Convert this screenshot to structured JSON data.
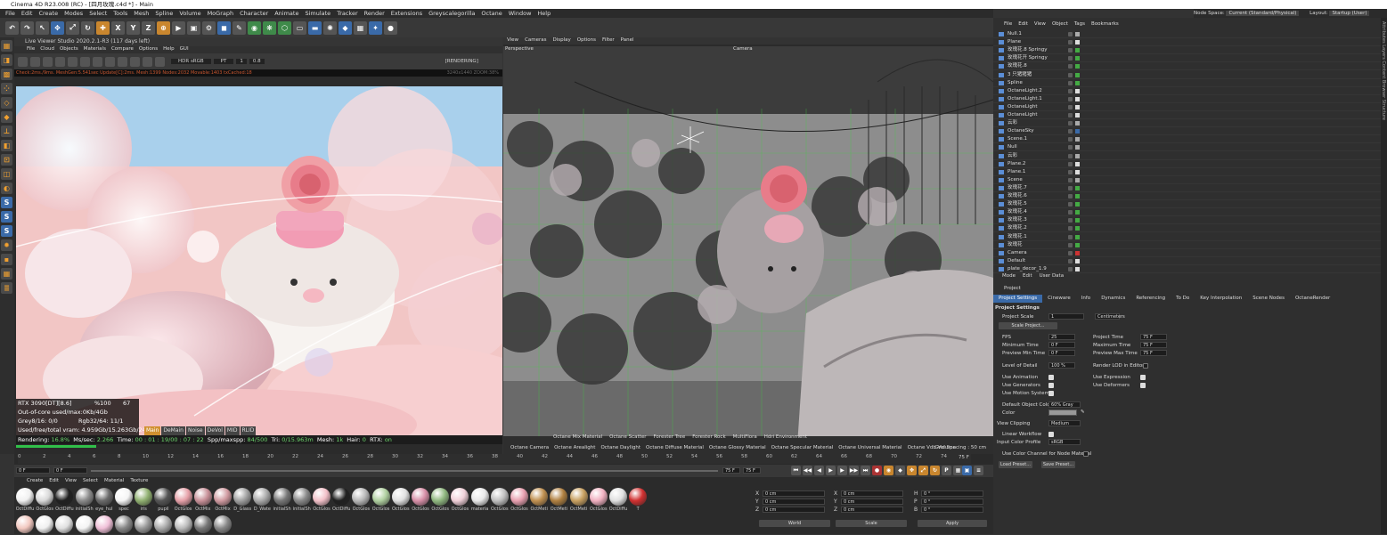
{
  "window": {
    "title": "Cinema 4D R23.008 (RC) - [四月玫瑰.c4d *] - Main"
  },
  "menubar": [
    "File",
    "Edit",
    "Create",
    "Modes",
    "Select",
    "Tools",
    "Mesh",
    "Spline",
    "Volume",
    "MoGraph",
    "Character",
    "Animate",
    "Simulate",
    "Tracker",
    "Render",
    "Extensions",
    "Greyscalegorilla",
    "Octane",
    "Window",
    "Help"
  ],
  "nodespace": {
    "label": "Node Space:",
    "value": "Current (Standard/Physical)",
    "layout_label": "Layout:",
    "layout_value": "Startup (User)"
  },
  "live_viewer": {
    "title": "Live Viewer Studio 2020.2.1-R3 (117 days left)",
    "menu": [
      "File",
      "Cloud",
      "Objects",
      "Materials",
      "Compare",
      "Options",
      "Help",
      "GUI"
    ],
    "status": "[RENDERING]",
    "hdr": "HDR sRGB",
    "pt": "PT",
    "one": "1",
    "zoom": "0.8",
    "info_line": "Check:2ms./9ms. MeshGen:5.541sec Update[C]:2ms. Mesh:1399 Nodes:2032 Movable:1403 txCached:18",
    "info_right": "3240x1440 ZOOM:38%",
    "stats": {
      "gpu": "RTX 3090[DT][8.6]",
      "gpu_pct": "%100",
      "gpu_temp": "67",
      "ooc": "Out-of-core used/max:0Kb/4Gb",
      "grey": "Grey8/16: 0/0",
      "rgb": "Rgb32/64: 11/1",
      "vram": "Used/free/total vram: 4.959Gb/15.263Gb/24Gb"
    },
    "tabs": [
      "Main",
      "DeMain",
      "Noise",
      "DeVol",
      "MID",
      "RLID"
    ],
    "bottom": {
      "rendering_label": "Rendering:",
      "rendering_val": "16.8%",
      "ms_label": "Ms/sec:",
      "ms_val": "2.266",
      "time_label": "Time:",
      "time_val": "00 : 01 : 19/00 : 07 : 22",
      "spp_label": "Spp/maxspp:",
      "spp_val": "84/500",
      "tri_label": "Tri:",
      "tri_val": "0/15.963m",
      "mesh_label": "Mesh:",
      "mesh_val": "1k",
      "hair_label": "Hair:",
      "hair_val": "0",
      "rtx_label": "RTX:",
      "rtx_val": "on"
    }
  },
  "viewport": {
    "menu": [
      "View",
      "Cameras",
      "Display",
      "Options",
      "Filter",
      "Panel"
    ],
    "label": "Perspective",
    "camera": "Camera",
    "bottom_items": [
      "Octane Mix Material",
      "Octane Scatter",
      "Forester Tree",
      "Forester Rock",
      "MultiFlora",
      "Hdri Environment"
    ],
    "bottom_items2": [
      "Octane Camera",
      "Octane Arealight",
      "Octane Daylight",
      "Octane Diffuse Material",
      "Octane Glossy Material",
      "Octane Specular Material",
      "Octane Universal Material",
      "Octane Vdb Volume"
    ],
    "grid_spacing": "Grid Spacing : 50 cm"
  },
  "timeline": {
    "ticks": [
      "0",
      "2",
      "4",
      "6",
      "8",
      "10",
      "12",
      "14",
      "16",
      "18",
      "20",
      "22",
      "24",
      "26",
      "28",
      "30",
      "32",
      "34",
      "36",
      "38",
      "40",
      "42",
      "44",
      "46",
      "48",
      "50",
      "52",
      "54",
      "56",
      "58",
      "60",
      "62",
      "64",
      "66",
      "68",
      "70",
      "72",
      "74"
    ],
    "frame_start": "0 F",
    "frame_cur": "0 F",
    "frame_end": "75 F",
    "frame_end2": "75 F",
    "right_frame": "75 F"
  },
  "material_manager": {
    "menu": [
      "Create",
      "Edit",
      "View",
      "Select",
      "Material",
      "Texture"
    ],
    "row1": [
      {
        "label": "OctDiffu",
        "color": "#f0f0f0"
      },
      {
        "label": "OctGlos",
        "color": "#d8d8d8"
      },
      {
        "label": "OctDiffu",
        "color": "#202020"
      },
      {
        "label": "initialSh",
        "color": "#8a8a8a"
      },
      {
        "label": "eye_hul",
        "color": "#6a6a6a"
      },
      {
        "label": "spec",
        "color": "#f5f5f5"
      },
      {
        "label": "iris",
        "color": "#90b070"
      },
      {
        "label": "pupil",
        "color": "#555"
      },
      {
        "label": "OctGlos",
        "color": "#e6a0a8"
      },
      {
        "label": "OctMix",
        "color": "#c89098"
      },
      {
        "label": "OctMix",
        "color": "#d09aa0"
      },
      {
        "label": "D_Glass",
        "color": "#a0a0a0"
      },
      {
        "label": "D_Wate",
        "color": "#aaaaaa"
      },
      {
        "label": "initialSh",
        "color": "#777"
      },
      {
        "label": "initialSh",
        "color": "#888"
      },
      {
        "label": "OctGlos",
        "color": "#f2c0c8"
      },
      {
        "label": "OctDiffu",
        "color": "#202020"
      },
      {
        "label": "OctGlos",
        "color": "#b8b8b8"
      },
      {
        "label": "OctGlos",
        "color": "#b0d0a0"
      },
      {
        "label": "OctGlos",
        "color": "#e0e0e0"
      },
      {
        "label": "OctGlos",
        "color": "#d890a8"
      },
      {
        "label": "OctGlos",
        "color": "#90b880"
      },
      {
        "label": "OctGlos",
        "color": "#f0d0d8"
      },
      {
        "label": "materia",
        "color": "#e8e8e8"
      },
      {
        "label": "OctGlos",
        "color": "#c0c0c0"
      },
      {
        "label": "OctGlos",
        "color": "#e8a0b0"
      },
      {
        "label": "OctMeti",
        "color": "#c09050"
      },
      {
        "label": "OctMeti",
        "color": "#b08040"
      },
      {
        "label": "OctMeti",
        "color": "#c8a060"
      },
      {
        "label": "OctGlos",
        "color": "#f0b0c0"
      },
      {
        "label": "OctDiffu",
        "color": "#e0e0e0"
      },
      {
        "label": "T",
        "color": "#d03030"
      }
    ],
    "row2_colors": [
      "#f2c8c0",
      "#f0f0f0",
      "#e0e0e0",
      "#f4f4f4",
      "#f0c0d8",
      "#888",
      "#999",
      "#aaa",
      "#bbb",
      "#777",
      "#888"
    ]
  },
  "coords": {
    "rows": [
      {
        "a": "X",
        "av": "0 cm",
        "b": "X",
        "bv": "0 cm",
        "c": "H",
        "cv": "0 °"
      },
      {
        "a": "Y",
        "av": "0 cm",
        "b": "Y",
        "bv": "0 cm",
        "c": "P",
        "cv": "0 °"
      },
      {
        "a": "Z",
        "av": "0 cm",
        "b": "Z",
        "bv": "0 cm",
        "c": "B",
        "cv": "0 °"
      }
    ],
    "world": "World",
    "scale": "Scale",
    "apply": "Apply"
  },
  "object_manager": {
    "menu": [
      "File",
      "Edit",
      "View",
      "Object",
      "Tags",
      "Bookmarks"
    ],
    "items": [
      {
        "name": "Null.1",
        "tag": "#aaa"
      },
      {
        "name": "Plane",
        "tag": "#ddd"
      },
      {
        "name": "玫瑰花.8 Springy",
        "tag": "#4a4"
      },
      {
        "name": "玫瑰花开 Springy",
        "tag": "#4a4"
      },
      {
        "name": "玫瑰花.8",
        "tag": "#4a4"
      },
      {
        "name": "3 只猪猪猪",
        "tag": "#4a4"
      },
      {
        "name": "Spline",
        "tag": "#4a4"
      },
      {
        "name": "OctaneLight.2",
        "tag": "#ddd"
      },
      {
        "name": "OctaneLight.1",
        "tag": "#ddd"
      },
      {
        "name": "OctaneLight",
        "tag": "#ddd"
      },
      {
        "name": "OctaneLight",
        "tag": "#ddd"
      },
      {
        "name": "云彩",
        "tag": "#aaa"
      },
      {
        "name": "OctaneSky",
        "tag": "#3a6aa8"
      },
      {
        "name": "Scene.1",
        "tag": "#aaa"
      },
      {
        "name": "Null",
        "tag": "#aaa"
      },
      {
        "name": "云彩",
        "tag": "#aaa"
      },
      {
        "name": "Plane.2",
        "tag": "#ddd"
      },
      {
        "name": "Plane.1",
        "tag": "#ddd"
      },
      {
        "name": "Scene",
        "tag": "#aaa"
      },
      {
        "name": "玫瑰花.7",
        "tag": "#4a4"
      },
      {
        "name": "玫瑰花.6",
        "tag": "#4a4"
      },
      {
        "name": "玫瑰花.5",
        "tag": "#4a4"
      },
      {
        "name": "玫瑰花.4",
        "tag": "#4a4"
      },
      {
        "name": "玫瑰花.3",
        "tag": "#4a4"
      },
      {
        "name": "玫瑰花.2",
        "tag": "#4a4"
      },
      {
        "name": "玫瑰花.1",
        "tag": "#4a4"
      },
      {
        "name": "玫瑰花",
        "tag": "#4a4"
      },
      {
        "name": "Camera",
        "tag": "#c33"
      },
      {
        "name": "Default",
        "tag": "#ddd"
      },
      {
        "name": "plate_decor_1.9",
        "tag": "#ddd"
      }
    ]
  },
  "attributes": {
    "menu": [
      "Mode",
      "Edit",
      "User Data"
    ],
    "object": "Project",
    "tabs": [
      "Project Settings",
      "Cineware",
      "Info",
      "Dynamics",
      "Referencing",
      "To Do",
      "Key Interpolation",
      "Scene Nodes",
      "OctaneRender"
    ],
    "section": "Project Settings",
    "project_scale_label": "Project Scale",
    "project_scale_val": "1",
    "project_scale_unit": "Centimeters",
    "scale_project_btn": "Scale Project...",
    "fps_label": "FPS",
    "fps_val": "25",
    "project_time_label": "Project Time",
    "project_time_val": "75 F",
    "min_time_label": "Minimum Time",
    "min_time_val": "0 F",
    "max_time_label": "Maximum Time",
    "max_time_val": "75 F",
    "prev_min_label": "Preview Min Time",
    "prev_min_val": "0 F",
    "prev_max_label": "Preview Max Time",
    "prev_max_val": "75 F",
    "lod_label": "Level of Detail",
    "lod_val": "100 %",
    "render_lod_label": "Render LOD in Editor",
    "use_anim_label": "Use Animation",
    "use_expr_label": "Use Expression",
    "use_gen_label": "Use Generators",
    "use_def_label": "Use Deformers",
    "use_motion_label": "Use Motion System",
    "def_color_label": "Default Object Color",
    "def_color_val": "60% Gray",
    "color_label": "Color",
    "view_clip_label": "View Clipping",
    "view_clip_val": "Medium",
    "linear_label": "Linear Workflow",
    "input_profile_label": "Input Color Profile",
    "input_profile_val": "sRGB",
    "use_color_channel_label": "Use Color Channel for Node Material",
    "load_preset": "Load Preset...",
    "save_preset": "Save Preset..."
  },
  "right_strip": "Attributes  Layers  Content Browser  Structure"
}
